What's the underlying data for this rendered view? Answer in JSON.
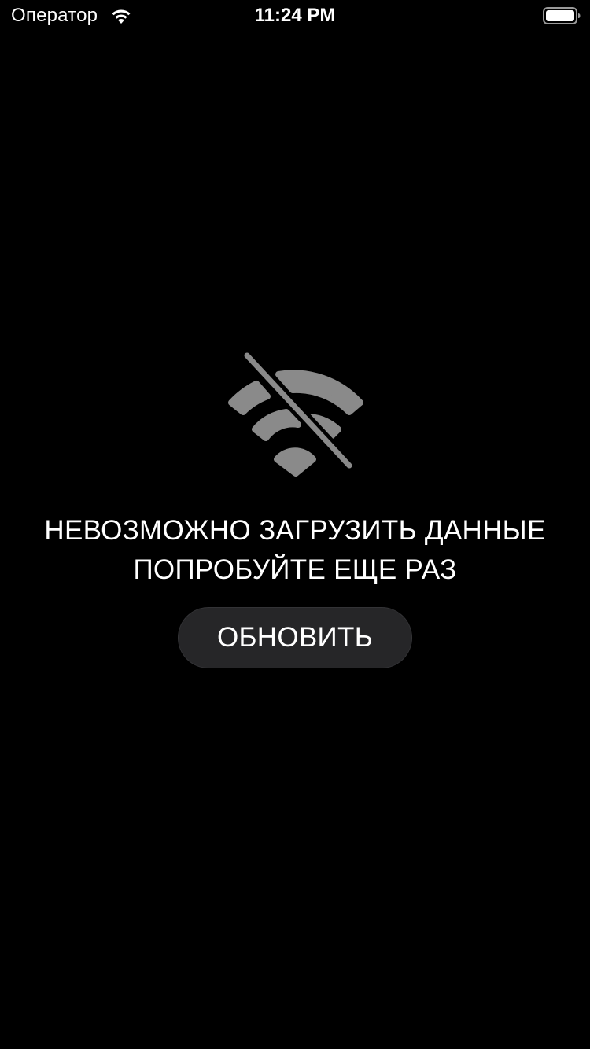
{
  "status_bar": {
    "carrier": "Оператор",
    "time": "11:24 PM",
    "wifi_icon": "wifi-icon",
    "battery_icon": "battery-full-icon"
  },
  "error": {
    "icon": "wifi-slash-icon",
    "line1": "НЕВОЗМОЖНО ЗАГРУЗИТЬ ДАННЫЕ",
    "line2": "ПОПРОБУЙТЕ ЕЩЕ РАЗ",
    "button_label": "ОБНОВИТЬ"
  },
  "colors": {
    "background": "#000000",
    "text": "#ffffff",
    "icon": "#8a8a8a",
    "button_bg": "#262628"
  }
}
